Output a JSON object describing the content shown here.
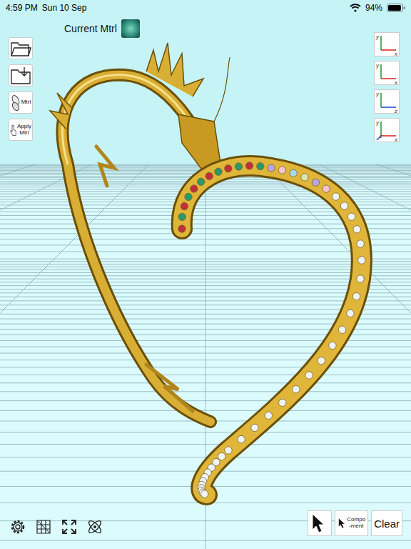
{
  "status_bar": {
    "time": "4:59 PM",
    "date": "Sun 10 Sep",
    "battery": "94%",
    "battery_level": 0.94
  },
  "current_material": {
    "label": "Current Mtrl",
    "color": "#2f8f7c"
  },
  "left_toolbar": [
    {
      "kind": "open"
    },
    {
      "kind": "save"
    },
    {
      "kind": "material",
      "lines": [
        "Mtrl"
      ]
    },
    {
      "kind": "apply",
      "lines": [
        "Apply",
        "Mtrl"
      ]
    }
  ],
  "view_buttons": [
    {
      "axes": [
        "y",
        "x"
      ],
      "selected": false
    },
    {
      "axes": [
        "y",
        "x"
      ],
      "selected": false
    },
    {
      "axes": [
        "y",
        "z"
      ],
      "selected": false
    },
    {
      "axes": [
        "y",
        "z",
        "x"
      ],
      "selected": false
    }
  ],
  "select_tools": [
    {
      "kind": "arrow",
      "lines": [],
      "selected": false
    },
    {
      "kind": "component",
      "lines": [
        "Compo",
        "-ment"
      ],
      "selected": false
    },
    {
      "kind": "clear",
      "lines": [
        "Clear"
      ],
      "selected": false
    }
  ]
}
